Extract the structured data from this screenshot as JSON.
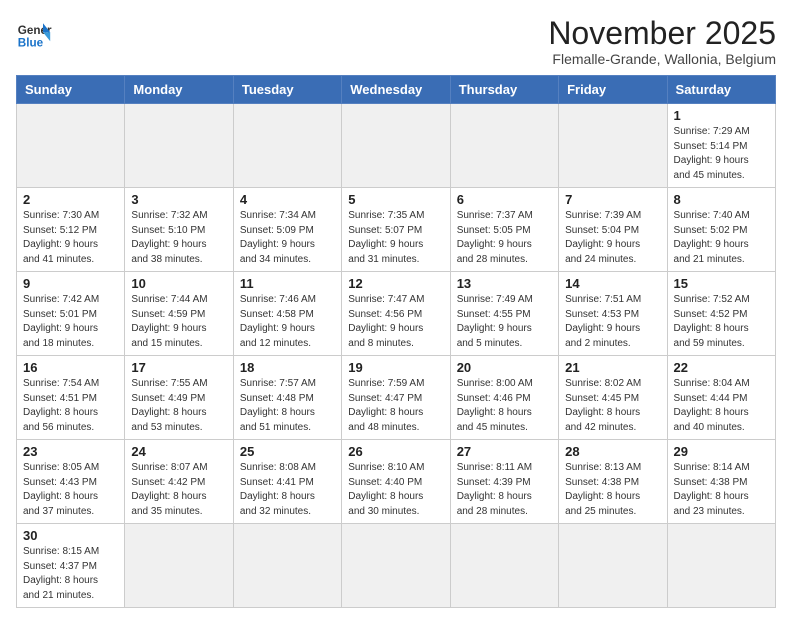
{
  "logo": {
    "text_general": "General",
    "text_blue": "Blue"
  },
  "title": "November 2025",
  "subtitle": "Flemalle-Grande, Wallonia, Belgium",
  "days_of_week": [
    "Sunday",
    "Monday",
    "Tuesday",
    "Wednesday",
    "Thursday",
    "Friday",
    "Saturday"
  ],
  "weeks": [
    [
      {
        "day": "",
        "info": ""
      },
      {
        "day": "",
        "info": ""
      },
      {
        "day": "",
        "info": ""
      },
      {
        "day": "",
        "info": ""
      },
      {
        "day": "",
        "info": ""
      },
      {
        "day": "",
        "info": ""
      },
      {
        "day": "1",
        "info": "Sunrise: 7:29 AM\nSunset: 5:14 PM\nDaylight: 9 hours\nand 45 minutes."
      }
    ],
    [
      {
        "day": "2",
        "info": "Sunrise: 7:30 AM\nSunset: 5:12 PM\nDaylight: 9 hours\nand 41 minutes."
      },
      {
        "day": "3",
        "info": "Sunrise: 7:32 AM\nSunset: 5:10 PM\nDaylight: 9 hours\nand 38 minutes."
      },
      {
        "day": "4",
        "info": "Sunrise: 7:34 AM\nSunset: 5:09 PM\nDaylight: 9 hours\nand 34 minutes."
      },
      {
        "day": "5",
        "info": "Sunrise: 7:35 AM\nSunset: 5:07 PM\nDaylight: 9 hours\nand 31 minutes."
      },
      {
        "day": "6",
        "info": "Sunrise: 7:37 AM\nSunset: 5:05 PM\nDaylight: 9 hours\nand 28 minutes."
      },
      {
        "day": "7",
        "info": "Sunrise: 7:39 AM\nSunset: 5:04 PM\nDaylight: 9 hours\nand 24 minutes."
      },
      {
        "day": "8",
        "info": "Sunrise: 7:40 AM\nSunset: 5:02 PM\nDaylight: 9 hours\nand 21 minutes."
      }
    ],
    [
      {
        "day": "9",
        "info": "Sunrise: 7:42 AM\nSunset: 5:01 PM\nDaylight: 9 hours\nand 18 minutes."
      },
      {
        "day": "10",
        "info": "Sunrise: 7:44 AM\nSunset: 4:59 PM\nDaylight: 9 hours\nand 15 minutes."
      },
      {
        "day": "11",
        "info": "Sunrise: 7:46 AM\nSunset: 4:58 PM\nDaylight: 9 hours\nand 12 minutes."
      },
      {
        "day": "12",
        "info": "Sunrise: 7:47 AM\nSunset: 4:56 PM\nDaylight: 9 hours\nand 8 minutes."
      },
      {
        "day": "13",
        "info": "Sunrise: 7:49 AM\nSunset: 4:55 PM\nDaylight: 9 hours\nand 5 minutes."
      },
      {
        "day": "14",
        "info": "Sunrise: 7:51 AM\nSunset: 4:53 PM\nDaylight: 9 hours\nand 2 minutes."
      },
      {
        "day": "15",
        "info": "Sunrise: 7:52 AM\nSunset: 4:52 PM\nDaylight: 8 hours\nand 59 minutes."
      }
    ],
    [
      {
        "day": "16",
        "info": "Sunrise: 7:54 AM\nSunset: 4:51 PM\nDaylight: 8 hours\nand 56 minutes."
      },
      {
        "day": "17",
        "info": "Sunrise: 7:55 AM\nSunset: 4:49 PM\nDaylight: 8 hours\nand 53 minutes."
      },
      {
        "day": "18",
        "info": "Sunrise: 7:57 AM\nSunset: 4:48 PM\nDaylight: 8 hours\nand 51 minutes."
      },
      {
        "day": "19",
        "info": "Sunrise: 7:59 AM\nSunset: 4:47 PM\nDaylight: 8 hours\nand 48 minutes."
      },
      {
        "day": "20",
        "info": "Sunrise: 8:00 AM\nSunset: 4:46 PM\nDaylight: 8 hours\nand 45 minutes."
      },
      {
        "day": "21",
        "info": "Sunrise: 8:02 AM\nSunset: 4:45 PM\nDaylight: 8 hours\nand 42 minutes."
      },
      {
        "day": "22",
        "info": "Sunrise: 8:04 AM\nSunset: 4:44 PM\nDaylight: 8 hours\nand 40 minutes."
      }
    ],
    [
      {
        "day": "23",
        "info": "Sunrise: 8:05 AM\nSunset: 4:43 PM\nDaylight: 8 hours\nand 37 minutes."
      },
      {
        "day": "24",
        "info": "Sunrise: 8:07 AM\nSunset: 4:42 PM\nDaylight: 8 hours\nand 35 minutes."
      },
      {
        "day": "25",
        "info": "Sunrise: 8:08 AM\nSunset: 4:41 PM\nDaylight: 8 hours\nand 32 minutes."
      },
      {
        "day": "26",
        "info": "Sunrise: 8:10 AM\nSunset: 4:40 PM\nDaylight: 8 hours\nand 30 minutes."
      },
      {
        "day": "27",
        "info": "Sunrise: 8:11 AM\nSunset: 4:39 PM\nDaylight: 8 hours\nand 28 minutes."
      },
      {
        "day": "28",
        "info": "Sunrise: 8:13 AM\nSunset: 4:38 PM\nDaylight: 8 hours\nand 25 minutes."
      },
      {
        "day": "29",
        "info": "Sunrise: 8:14 AM\nSunset: 4:38 PM\nDaylight: 8 hours\nand 23 minutes."
      }
    ],
    [
      {
        "day": "30",
        "info": "Sunrise: 8:15 AM\nSunset: 4:37 PM\nDaylight: 8 hours\nand 21 minutes."
      },
      {
        "day": "",
        "info": ""
      },
      {
        "day": "",
        "info": ""
      },
      {
        "day": "",
        "info": ""
      },
      {
        "day": "",
        "info": ""
      },
      {
        "day": "",
        "info": ""
      },
      {
        "day": "",
        "info": ""
      }
    ]
  ]
}
